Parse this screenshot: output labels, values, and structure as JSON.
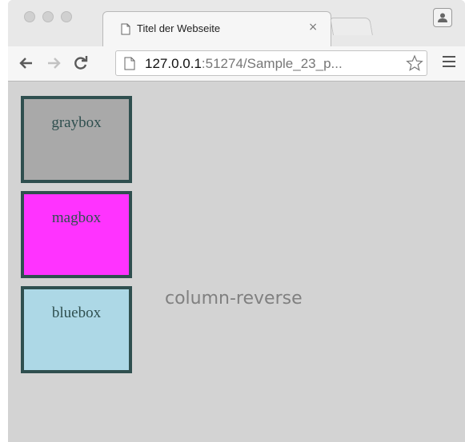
{
  "browser": {
    "tab": {
      "title": "Titel der Webseite",
      "close_glyph": "×",
      "icon": "page-icon"
    },
    "address_bar": {
      "url_host": "127.0.0.1",
      "url_rest": ":51274/Sample_23_p..."
    },
    "icons": {
      "back": "back-arrow-icon",
      "forward": "forward-arrow-icon",
      "reload": "reload-icon",
      "bookmark": "star-icon",
      "menu": "hamburger-menu-icon",
      "profile": "profile-icon"
    }
  },
  "page": {
    "boxes": [
      {
        "label": "graybox",
        "color": "#a9a9a9"
      },
      {
        "label": "magbox",
        "color": "#ff33ff"
      },
      {
        "label": "bluebox",
        "color": "#add8e6"
      }
    ],
    "caption": "column-reverse",
    "colors": {
      "border": "#2f4f4f",
      "background": "#d3d3d3",
      "caption": "#808080"
    }
  }
}
